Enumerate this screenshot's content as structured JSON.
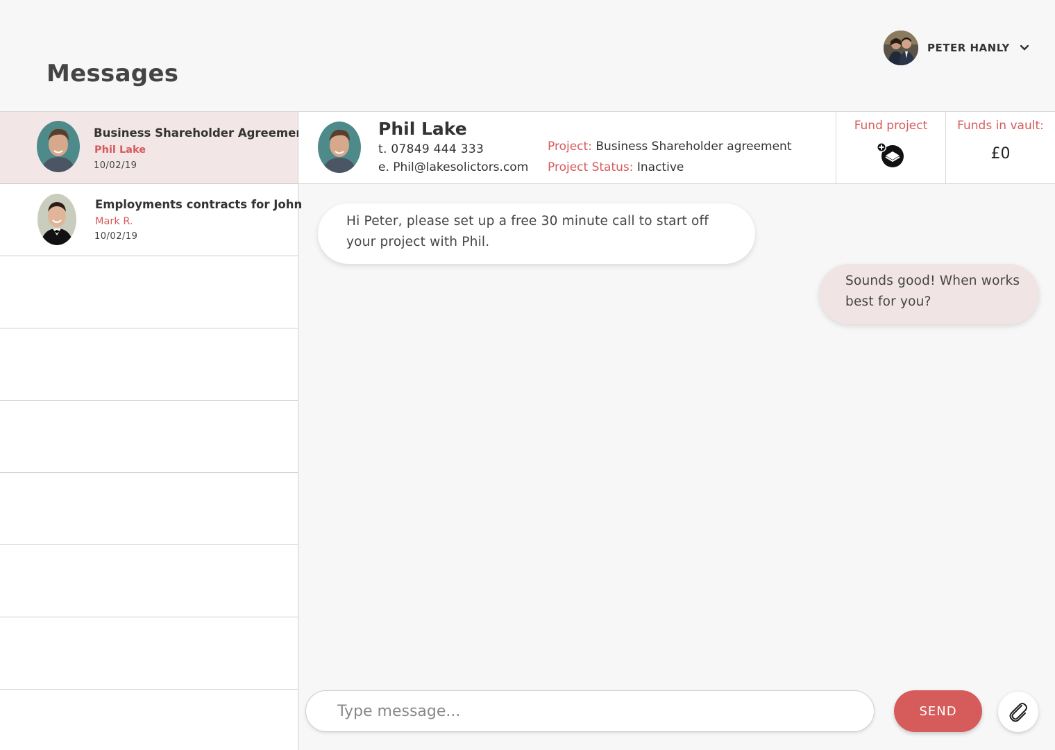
{
  "page": {
    "title": "Messages"
  },
  "user": {
    "name": "PETER HANLY"
  },
  "conversations": [
    {
      "title": "Business Shareholder Agreement",
      "contact": "Phil Lake",
      "date": "10/02/19",
      "active": true
    },
    {
      "title": "Employments contracts for John",
      "contact": "Mark R.",
      "date": "10/02/19",
      "active": false
    }
  ],
  "contact": {
    "name": "Phil Lake",
    "phone": "t. 07849 444 333",
    "email": "e. Phil@lakesolictors.com",
    "project_label": "Project:",
    "project_value": "Business Shareholder agreement",
    "status_label": "Project Status:",
    "status_value": "Inactive"
  },
  "fund": {
    "label": "Fund project"
  },
  "vault": {
    "label": "Funds in vault:",
    "value": "£0"
  },
  "messages": [
    {
      "from": "contact",
      "text": "Hi Peter, please set up a free 30 minute call to start off your project with Phil."
    },
    {
      "from": "user",
      "text": "Sounds good! When works best for you?"
    }
  ],
  "composer": {
    "placeholder": "Type message...",
    "send_label": "SEND"
  },
  "colors": {
    "accent": "#d65b5b",
    "active_row": "#f2e6e6",
    "outgoing_bubble": "#f0e4e4"
  }
}
